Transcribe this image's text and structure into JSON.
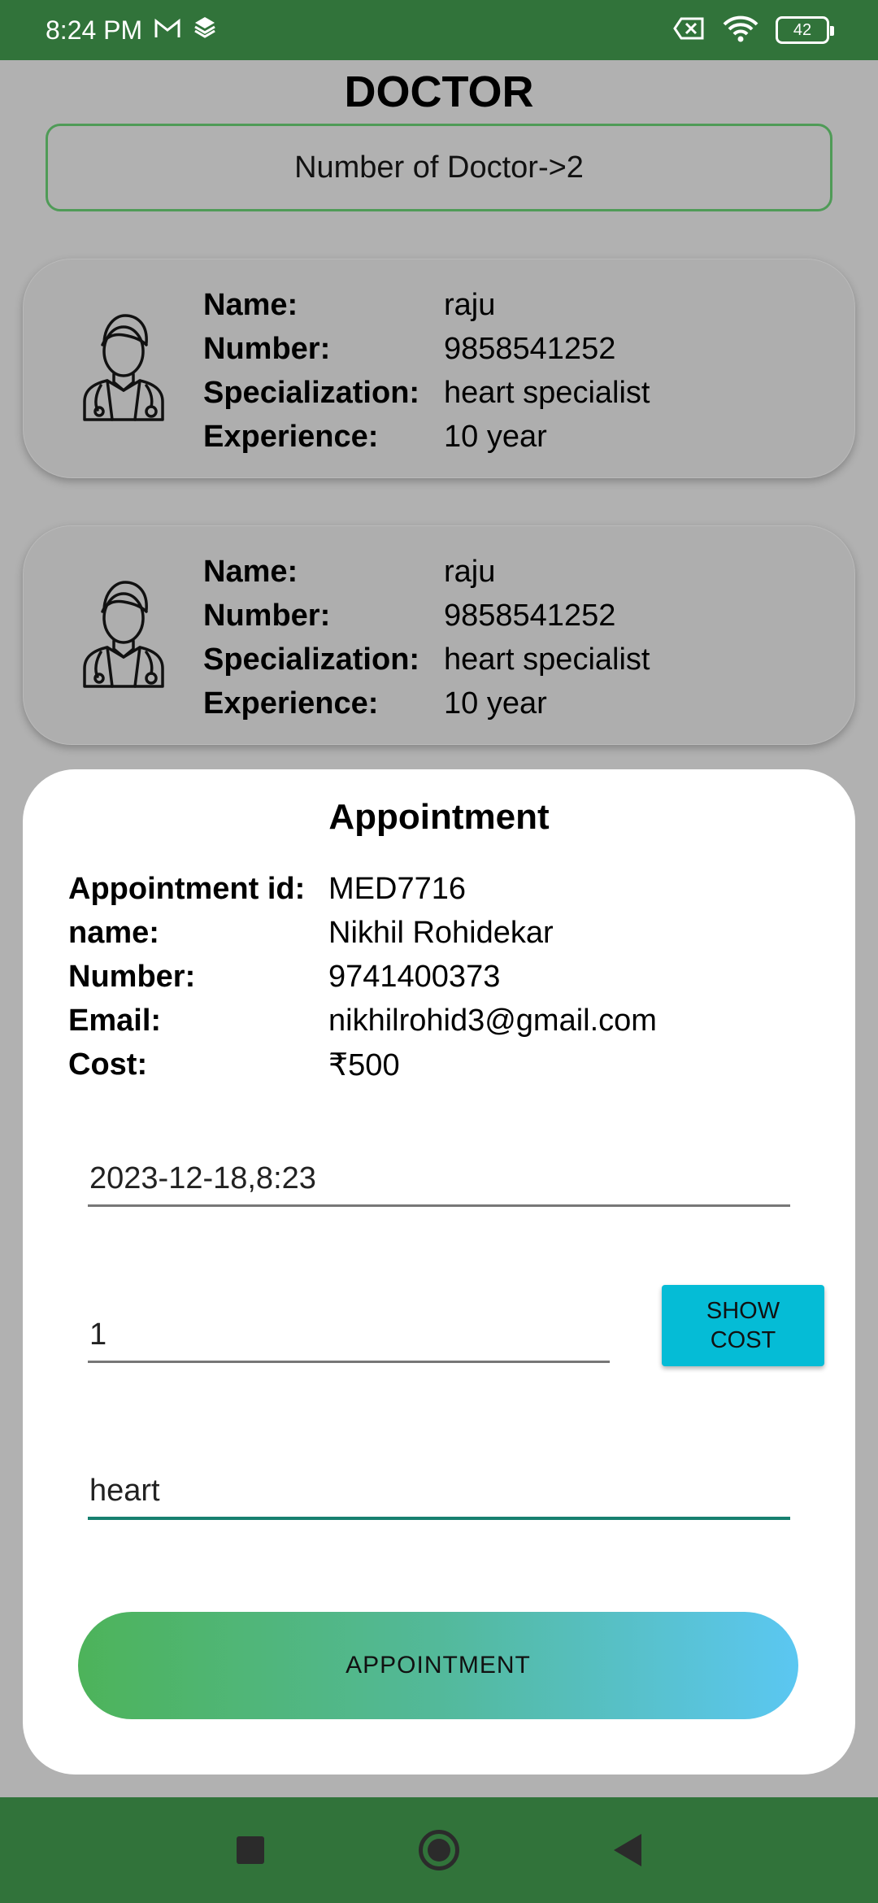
{
  "status_bar": {
    "time": "8:24 PM",
    "icons": [
      "gmail-icon",
      "layers-icon",
      "no-sim-icon",
      "wifi-icon",
      "battery-icon"
    ],
    "battery": "42"
  },
  "page": {
    "title": "DOCTOR",
    "counter": "Number of Doctor->2"
  },
  "doctors": [
    {
      "name_label": "Name:",
      "name": "raju",
      "number_label": "Number:",
      "number": "9858541252",
      "spec_label": "Specialization:",
      "specialization": "heart specialist",
      "exp_label": "Experience:",
      "experience": "10 year"
    },
    {
      "name_label": "Name:",
      "name": "raju",
      "number_label": "Number:",
      "number": "9858541252",
      "spec_label": "Specialization:",
      "specialization": "heart specialist",
      "exp_label": "Experience:",
      "experience": "10 year"
    }
  ],
  "appointment": {
    "title": "Appointment",
    "rows": [
      {
        "label": "Appointment id:",
        "value": "MED7716"
      },
      {
        "label": "name:",
        "value": "Nikhil Rohidekar"
      },
      {
        "label": "Number:",
        "value": "9741400373"
      },
      {
        "label": "Email:",
        "value": "nikhilrohid3@gmail.com"
      },
      {
        "label": "Cost:",
        "value": "₹500"
      }
    ],
    "date_value": "2023-12-18,8:23",
    "quantity_value": "1",
    "show_cost_label": "SHOW COST",
    "problem_value": "heart",
    "submit_label": "APPOINTMENT"
  },
  "colors": {
    "bar_green": "#31733a",
    "accent_cyan": "#05bcd6",
    "focus_teal": "#17806f"
  }
}
